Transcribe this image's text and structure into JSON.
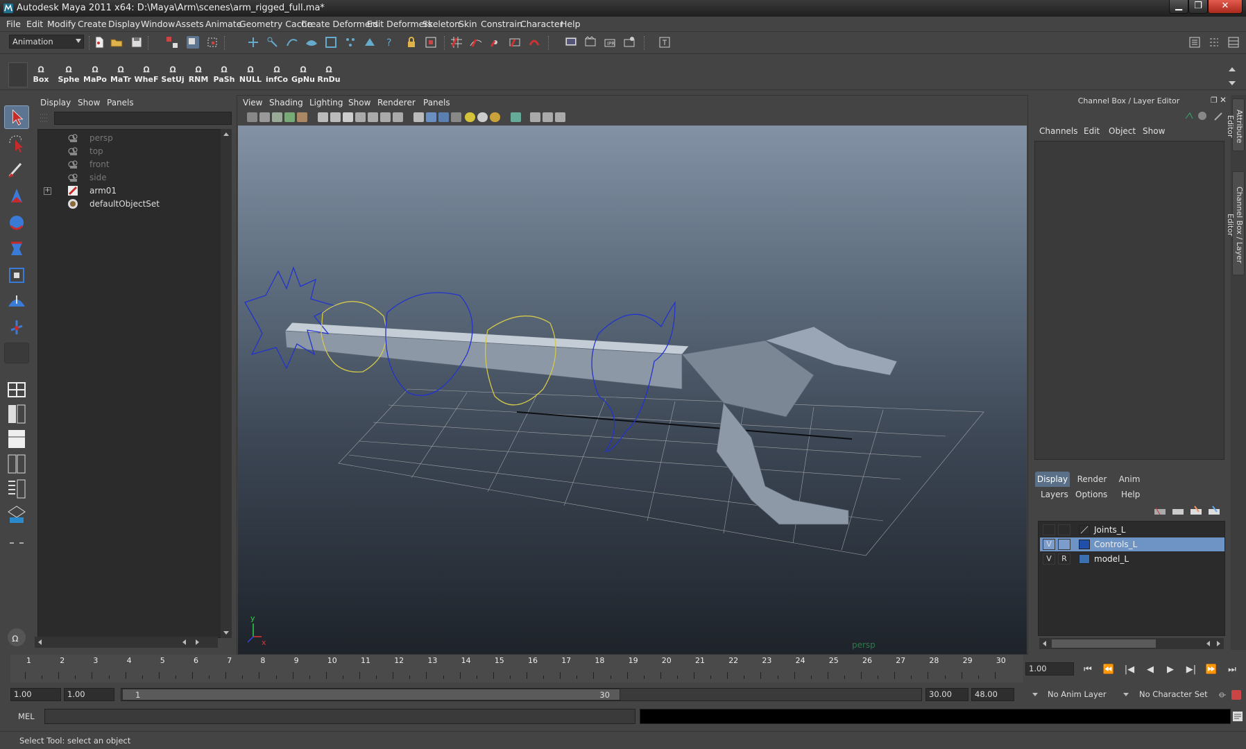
{
  "window": {
    "title": "Autodesk Maya 2011 x64: D:\\Maya\\Arm\\scenes\\arm_rigged_full.ma*",
    "min_glyph": "▁",
    "max_glyph": "❐",
    "close_glyph": "✕"
  },
  "menubar": [
    "File",
    "Edit",
    "Modify",
    "Create",
    "Display",
    "Window",
    "Assets",
    "Animate",
    "Geometry Cache",
    "Create Deformers",
    "Edit Deformers",
    "Skeleton",
    "Skin",
    "Constrain",
    "Character",
    "Help"
  ],
  "statusline": {
    "mode": "Animation",
    "command_field": ""
  },
  "shelf": {
    "buttons": [
      "Box",
      "Sphe",
      "MaPo",
      "MaTr",
      "WheF",
      "SetUj",
      "RNM",
      "PaSh",
      "NULL",
      "infCo",
      "GpNu",
      "RnDu"
    ]
  },
  "outliner": {
    "menu": [
      "Display",
      "Show",
      "Panels"
    ],
    "filter": "",
    "items": [
      {
        "label": "persp",
        "kind": "camera"
      },
      {
        "label": "top",
        "kind": "camera"
      },
      {
        "label": "front",
        "kind": "camera"
      },
      {
        "label": "side",
        "kind": "camera"
      },
      {
        "label": "arm01",
        "kind": "group",
        "expand": "+"
      },
      {
        "label": "defaultObjectSet",
        "kind": "set"
      }
    ]
  },
  "viewport": {
    "menu": [
      "View",
      "Shading",
      "Lighting",
      "Show",
      "Renderer",
      "Panels"
    ],
    "camera_label": "persp",
    "axis_y": "y",
    "axis_x": "x"
  },
  "channel_box": {
    "title": "Channel Box / Layer Editor",
    "menu": [
      "Channels",
      "Edit",
      "Object",
      "Show"
    ],
    "side_tabs": [
      "Attribute Editor",
      "Channel Box / Layer Editor"
    ]
  },
  "layer_editor": {
    "tabs": [
      "Display",
      "Render",
      "Anim"
    ],
    "active_tab": "Display",
    "menu": [
      "Layers",
      "Options",
      "Help"
    ],
    "layers": [
      {
        "v": "",
        "r": "",
        "name": "Joints_L",
        "color": "#2b2b2b",
        "selected": false
      },
      {
        "v": "V",
        "r": "",
        "name": "Controls_L",
        "color": "#1f4fa8",
        "selected": true
      },
      {
        "v": "V",
        "r": "R",
        "name": "model_L",
        "color": "#3b6fb0",
        "selected": false
      }
    ]
  },
  "time_slider": {
    "frames": [
      "1",
      "2",
      "3",
      "4",
      "5",
      "6",
      "7",
      "8",
      "9",
      "10",
      "11",
      "12",
      "13",
      "14",
      "15",
      "16",
      "17",
      "18",
      "19",
      "20",
      "21",
      "22",
      "23",
      "24",
      "25",
      "26",
      "27",
      "28",
      "29",
      "30"
    ],
    "current_frame": "1.00",
    "playback_glyphs": [
      "⏮",
      "⏪",
      "|◀",
      "◀",
      "▶",
      "▶|",
      "⏩",
      "⏭"
    ]
  },
  "range": {
    "start": "1.00",
    "playback_start": "1.00",
    "slider_start": "1",
    "slider_end": "30",
    "playback_end": "30.00",
    "end": "48.00",
    "anim_layer": "No Anim Layer",
    "character_set": "No Character Set"
  },
  "command_line": {
    "label": "MEL",
    "input": "",
    "output": ""
  },
  "help_line": "Select Tool: select an object"
}
